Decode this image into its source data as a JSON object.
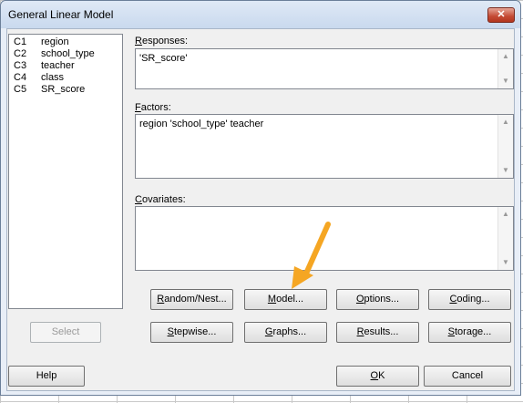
{
  "window": {
    "title": "General Linear Model",
    "close_label": "✕"
  },
  "variables": [
    {
      "id": "C1",
      "name": "region"
    },
    {
      "id": "C2",
      "name": "school_type"
    },
    {
      "id": "C3",
      "name": "teacher"
    },
    {
      "id": "C4",
      "name": "class"
    },
    {
      "id": "C5",
      "name": "SR_score"
    }
  ],
  "responses": {
    "label_first": "R",
    "label_rest": "esponses:",
    "value": "'SR_score'"
  },
  "factors": {
    "label_first": "F",
    "label_rest": "actors:",
    "value": "region 'school_type' teacher"
  },
  "covariates": {
    "label_first": "C",
    "label_rest": "ovariates:",
    "value": ""
  },
  "buttons": {
    "select": "Select",
    "random_nest": {
      "first": "R",
      "rest": "andom/Nest..."
    },
    "model": {
      "first": "M",
      "rest": "odel..."
    },
    "options": {
      "first": "O",
      "rest": "ptions..."
    },
    "coding": {
      "first": "C",
      "rest": "oding..."
    },
    "stepwise": {
      "first": "S",
      "rest": "tepwise..."
    },
    "graphs": {
      "first": "G",
      "rest": "raphs..."
    },
    "results": {
      "first": "R",
      "rest": "esults..."
    },
    "storage": {
      "first": "S",
      "rest": "torage..."
    },
    "help": "Help",
    "ok": {
      "first": "O",
      "rest": "K"
    },
    "cancel": "Cancel"
  },
  "colors": {
    "annotation_arrow": "#f5a623"
  }
}
